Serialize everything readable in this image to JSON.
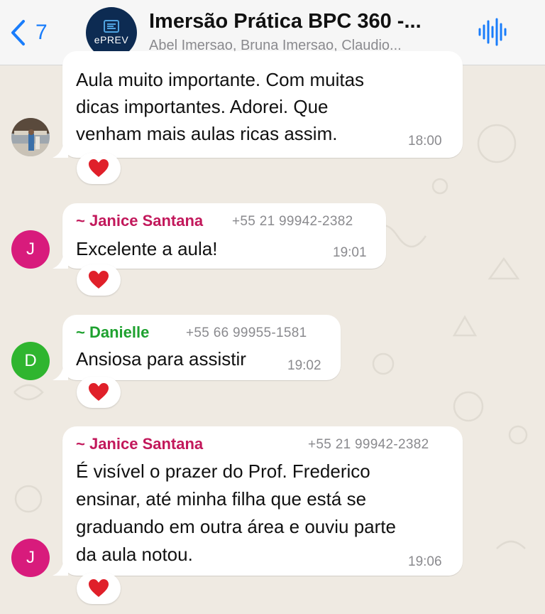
{
  "header": {
    "back_count": "7",
    "group_avatar_text": "ePREV",
    "title": "Imersão Prática BPC 360 -...",
    "subtitle": "Abel Imersao, Bruna Imersao, Claudio..."
  },
  "colors": {
    "accent_blue": "#1a7dfb",
    "sender_pink": "#c2185b",
    "sender_green": "#1ea12f",
    "avatar_pink": "#d81b7c",
    "avatar_green": "#2fb52f",
    "chat_background": "#efeae2"
  },
  "icons": {
    "back": "chevron-left-icon",
    "audio": "audio-waveform-icon",
    "reaction": "red-heart-icon"
  },
  "messages": [
    {
      "lines": [
        "Aula muito importante.  Com muitas",
        "dicas importantes.  Adorei. Que",
        "venham mais aulas ricas assim."
      ],
      "time": "18:00",
      "reaction": "❤️"
    },
    {
      "sender": "~ Janice Santana",
      "phone": "+55 21 99942-2382",
      "avatar_letter": "J",
      "lines": [
        "Excelente a aula!"
      ],
      "time": "19:01",
      "reaction": "❤️"
    },
    {
      "sender": "~ Danielle",
      "phone": "+55 66 99955-1581",
      "avatar_letter": "D",
      "lines": [
        "Ansiosa para assistir"
      ],
      "time": "19:02",
      "reaction": "❤️"
    },
    {
      "sender": "~ Janice Santana",
      "phone": "+55 21 99942-2382",
      "avatar_letter": "J",
      "lines": [
        "É visível o prazer do Prof. Frederico",
        "ensinar, até minha filha que está se",
        "graduando em outra área e ouviu parte",
        "da aula notou."
      ],
      "time": "19:06",
      "reaction": "❤️"
    }
  ]
}
